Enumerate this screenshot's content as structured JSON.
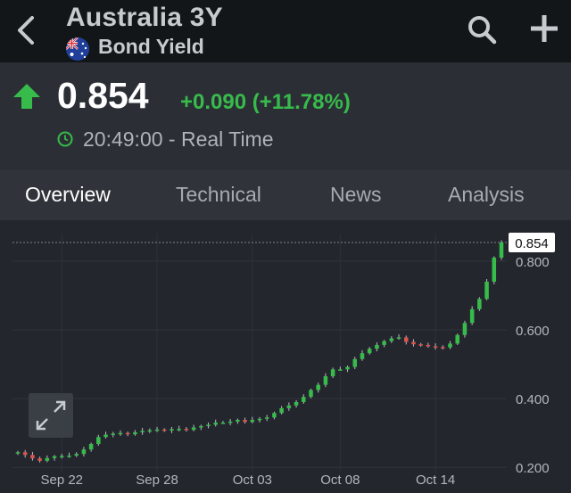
{
  "header": {
    "title": "Australia 3Y",
    "subtitle": "Bond Yield",
    "icons": [
      "back-chevron",
      "australia-flag",
      "search",
      "plus"
    ]
  },
  "quote": {
    "price": "0.854",
    "change": "+0.090 (+11.78%)",
    "time": "20:49:00 - Real Time",
    "direction": "up",
    "up_color": "#37bb4b",
    "down_color": "#d9534f"
  },
  "tabs": [
    {
      "label": "Overview",
      "active": true
    },
    {
      "label": "Technical",
      "active": false
    },
    {
      "label": "News",
      "active": false
    },
    {
      "label": "Analysis",
      "active": false
    }
  ],
  "chart_data": {
    "type": "candlestick",
    "last_value_label": "0.854",
    "last_value": 0.854,
    "y_ticks": [
      "0.800",
      "0.600",
      "0.400",
      "0.200"
    ],
    "y_tick_values": [
      0.8,
      0.6,
      0.4,
      0.2
    ],
    "ylim": [
      0.185,
      0.88
    ],
    "x_ticks": [
      "Sep 22",
      "Sep 28",
      "Oct 03",
      "Oct 08",
      "Oct 14"
    ],
    "x_tick_index": [
      6,
      19,
      32,
      44,
      57
    ],
    "grid": true,
    "closes": [
      0.244,
      0.236,
      0.226,
      0.219,
      0.227,
      0.232,
      0.233,
      0.234,
      0.239,
      0.252,
      0.268,
      0.288,
      0.295,
      0.298,
      0.3,
      0.296,
      0.302,
      0.306,
      0.308,
      0.31,
      0.307,
      0.311,
      0.312,
      0.309,
      0.316,
      0.32,
      0.324,
      0.33,
      0.33,
      0.333,
      0.338,
      0.332,
      0.338,
      0.341,
      0.345,
      0.358,
      0.372,
      0.38,
      0.39,
      0.405,
      0.425,
      0.44,
      0.465,
      0.485,
      0.485,
      0.492,
      0.515,
      0.532,
      0.545,
      0.556,
      0.567,
      0.575,
      0.578,
      0.565,
      0.558,
      0.556,
      0.552,
      0.55,
      0.549,
      0.56,
      0.585,
      0.62,
      0.66,
      0.69,
      0.74,
      0.81,
      0.854
    ]
  }
}
